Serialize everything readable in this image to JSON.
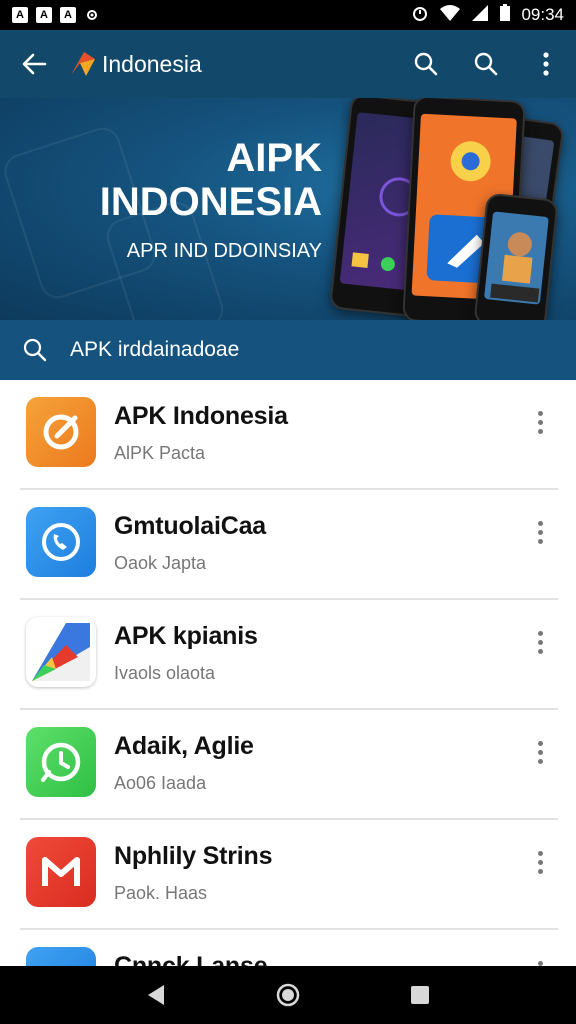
{
  "status_bar": {
    "left_icons": [
      "A",
      "A",
      "A",
      "settings-icon"
    ],
    "time": "09:34"
  },
  "app_bar": {
    "title": "Indonesia",
    "brand_color": "#12496b"
  },
  "banner": {
    "title_line1": "AIPK",
    "title_line2": "INDONESIA",
    "subtitle": "APR IND DDOINSIAY"
  },
  "search": {
    "query": "APK irddainadoae"
  },
  "apps": [
    {
      "name": "APK Indonesia",
      "subtitle": "AlPK Pacta",
      "icon": "target-icon",
      "color": "#f0892a"
    },
    {
      "name": "GmtuolaiCaa",
      "subtitle": "Oaok Japta",
      "icon": "phone-icon",
      "color": "#2f8fe8"
    },
    {
      "name": "APK kpianis",
      "subtitle": "Ivaols olaota",
      "icon": "maps-icon",
      "color": "#ffffff"
    },
    {
      "name": "Adaik, Aglie",
      "subtitle": "Ao06 Iaada",
      "icon": "alarm-icon",
      "color": "#3ecf5a"
    },
    {
      "name": "Nphlily Strins",
      "subtitle": "Paok. Haas",
      "icon": "gmail-icon",
      "color": "#e53a2c"
    },
    {
      "name": "Cnnck Lanse",
      "subtitle": "",
      "icon": "blue-app-icon",
      "color": "#2f8fe8"
    }
  ]
}
